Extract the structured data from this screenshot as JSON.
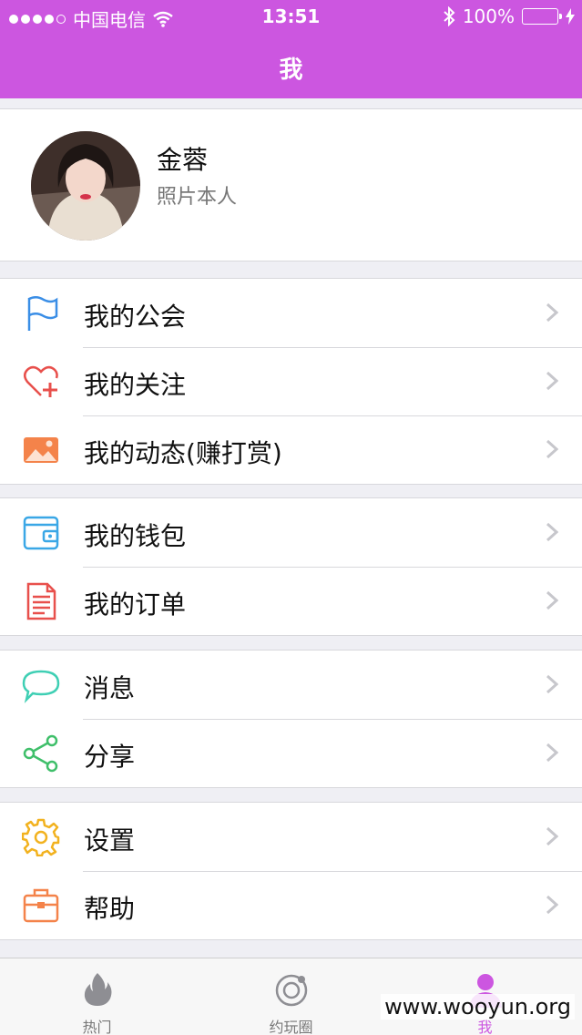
{
  "status_bar": {
    "carrier": "中国电信",
    "time": "13:51",
    "battery": "100%"
  },
  "nav": {
    "title": "我"
  },
  "profile": {
    "name": "金蓉",
    "subtitle": "照片本人"
  },
  "groups": [
    [
      {
        "label": "我的公会",
        "icon": "flag-icon",
        "color": "#3a8ee6"
      },
      {
        "label": "我的关注",
        "icon": "heart-plus-icon",
        "color": "#e8504c"
      },
      {
        "label": "我的动态(赚打赏)",
        "icon": "image-icon",
        "color": "#f4834a"
      }
    ],
    [
      {
        "label": "我的钱包",
        "icon": "wallet-icon",
        "color": "#3aa7e6"
      },
      {
        "label": "我的订单",
        "icon": "document-icon",
        "color": "#e8504c"
      }
    ],
    [
      {
        "label": "消息",
        "icon": "chat-bubble-icon",
        "color": "#3fcfb4"
      },
      {
        "label": "分享",
        "icon": "share-icon",
        "color": "#3fbf6a"
      }
    ],
    [
      {
        "label": "设置",
        "icon": "gear-icon",
        "color": "#f2b21f"
      },
      {
        "label": "帮助",
        "icon": "toolbox-icon",
        "color": "#f4834a"
      }
    ]
  ],
  "tabs": [
    {
      "label": "热门",
      "icon": "flame-icon"
    },
    {
      "label": "约玩圈",
      "icon": "orbit-icon"
    },
    {
      "label": "我",
      "icon": "person-icon",
      "active": true
    }
  ],
  "watermark": "www.wooyun.org",
  "colors": {
    "accent": "#cc56e0"
  }
}
